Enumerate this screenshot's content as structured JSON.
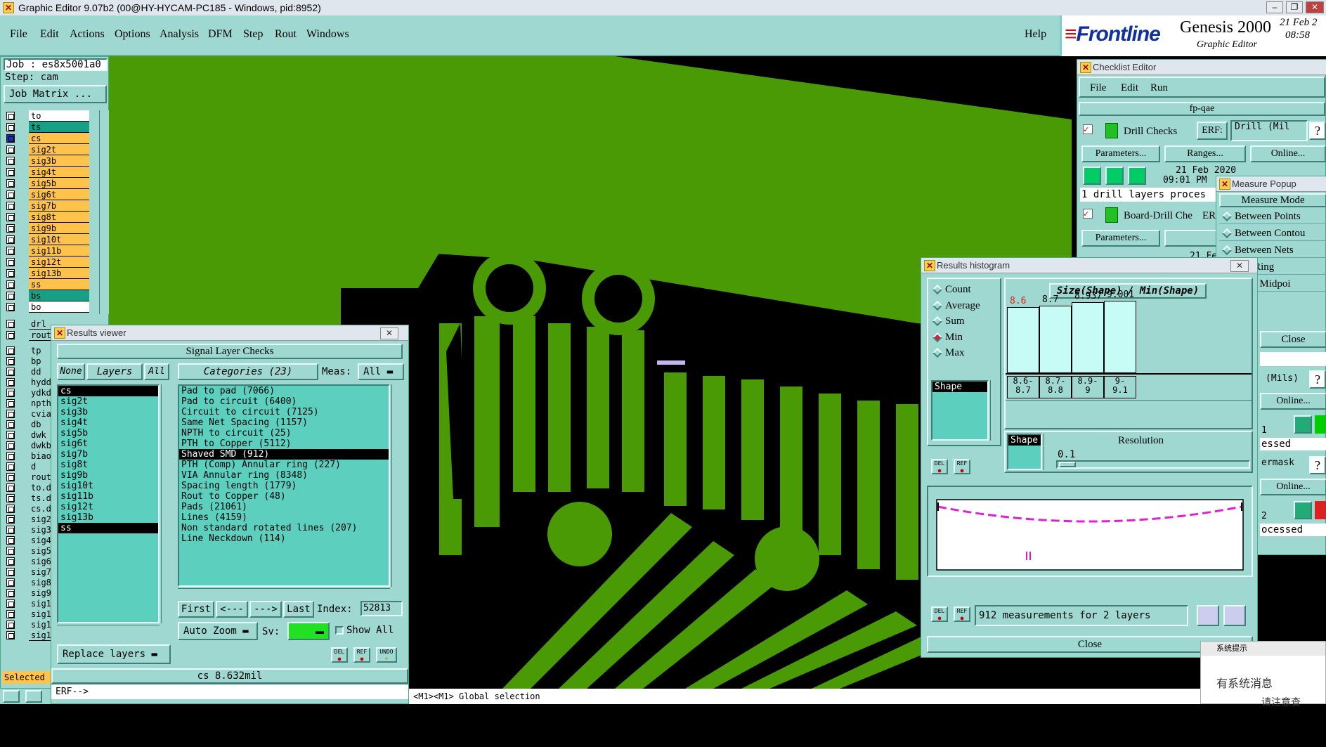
{
  "window": {
    "title": "Graphic Editor 9.07b2 (00@HY-HYCAM-PC185 - Windows, pid:8952)"
  },
  "menu": [
    "File",
    "Edit",
    "Actions",
    "Options",
    "Analysis",
    "DFM",
    "Step",
    "Rout",
    "Windows"
  ],
  "help": "Help",
  "brand": {
    "logo": "Frontline",
    "product": "Genesis 2000",
    "sub": "Graphic Editor",
    "date": "21 Feb 2",
    "time": "08:58 "
  },
  "job": {
    "job": "Job : es8x5001a0",
    "step": "Step: cam",
    "matrix": "Job Matrix ..."
  },
  "layers": [
    {
      "name": "to",
      "color": "#ffffff",
      "mark": "e"
    },
    {
      "name": "ts",
      "color": "#16a085"
    },
    {
      "name": "cs",
      "color": "#ffc24a",
      "mark": "▪",
      "active": true
    },
    {
      "name": "sig2t",
      "color": "#ffc24a"
    },
    {
      "name": "sig3b",
      "color": "#ffc24a"
    },
    {
      "name": "sig4t",
      "color": "#ffc24a"
    },
    {
      "name": "sig5b",
      "color": "#ffc24a"
    },
    {
      "name": "sig6t",
      "color": "#ffc24a"
    },
    {
      "name": "sig7b",
      "color": "#ffc24a"
    },
    {
      "name": "sig8t",
      "color": "#ffc24a"
    },
    {
      "name": "sig9b",
      "color": "#ffc24a"
    },
    {
      "name": "sig10t",
      "color": "#ffc24a"
    },
    {
      "name": "sig11b",
      "color": "#ffc24a"
    },
    {
      "name": "sig12t",
      "color": "#ffc24a"
    },
    {
      "name": "sig13b",
      "color": "#ffc24a"
    },
    {
      "name": "ss",
      "color": "#ffc24a"
    },
    {
      "name": "bs",
      "color": "#16a085"
    },
    {
      "name": "bo",
      "color": "#ffffff",
      "mark": "e"
    }
  ],
  "layers2": [
    "drl",
    "rout",
    "tp",
    "bp",
    "dd",
    "hydd",
    "ydkd",
    "npth",
    "cvia",
    "db",
    "dwk",
    "dwkb",
    "biao",
    "d",
    "rout",
    "to.d",
    "ts.d",
    "cs.d",
    "sig2",
    "sig3",
    "sig4",
    "sig5",
    "sig6",
    "sig7",
    "sig8",
    "sig9",
    "sig1",
    "sig1",
    "sig1",
    "sig1"
  ],
  "selected_label": "Selected",
  "results_viewer": {
    "title": "Results viewer",
    "header": "Signal Layer Checks",
    "none": "None",
    "layers_btn": "Layers",
    "all": "All",
    "categories": "Categories (23)",
    "meas_label": "Meas:",
    "meas_value": "All",
    "layer_list": [
      {
        "t": "cs",
        "sel": true
      },
      {
        "t": "sig2t"
      },
      {
        "t": "sig3b"
      },
      {
        "t": "sig4t"
      },
      {
        "t": "sig5b"
      },
      {
        "t": "sig6t"
      },
      {
        "t": "sig7b"
      },
      {
        "t": "sig8t"
      },
      {
        "t": "sig9b"
      },
      {
        "t": "sig10t"
      },
      {
        "t": "sig11b"
      },
      {
        "t": "sig12t"
      },
      {
        "t": "sig13b"
      },
      {
        "t": "ss",
        "sel": true
      }
    ],
    "cat_list": [
      {
        "t": "Pad to pad (7066)"
      },
      {
        "t": "Pad to circuit (6400)"
      },
      {
        "t": "Circuit to circuit (7125)"
      },
      {
        "t": "Same Net Spacing (1157)"
      },
      {
        "t": "NPTH to circuit (25)"
      },
      {
        "t": "PTH to Copper (5112)"
      },
      {
        "t": "Shaved SMD (912)",
        "sel": true
      },
      {
        "t": "PTH (Comp) Annular ring (227)"
      },
      {
        "t": "VIA Annular ring (8348)"
      },
      {
        "t": "Spacing length (1779)"
      },
      {
        "t": "Rout to Copper (48)"
      },
      {
        "t": "Pads (21061)"
      },
      {
        "t": "Lines (4159)"
      },
      {
        "t": "Non standard rotated lines (207)"
      },
      {
        "t": "Line Neckdown (114)"
      }
    ],
    "first": "First",
    "prev": "<---",
    "next": "--->",
    "last": "Last",
    "index_label": "Index:",
    "index_value": "52813",
    "auto_zoom": "Auto Zoom",
    "sv": "Sv:",
    "show_all": "Show All",
    "replace": "Replace layers",
    "del": "DEL",
    "ref": "REF",
    "undo": "UNDO",
    "status": "cs 8.632mil",
    "erf": "ERF-->"
  },
  "results_histogram": {
    "title": "Results histogram",
    "modes": [
      {
        "t": "Count"
      },
      {
        "t": "Average"
      },
      {
        "t": "Sum"
      },
      {
        "t": "Min",
        "on": true
      },
      {
        "t": "Max"
      }
    ],
    "shape": "Shape",
    "chart_title": "Size(Shape) / Min(Shape)",
    "bins": [
      {
        "value": "8.6",
        "range": "8.6-\n8.7",
        "h": 0.72,
        "red": true
      },
      {
        "value": "8.7",
        "range": "8.7-\n8.8",
        "h": 0.74
      },
      {
        "value": "8.937",
        "range": "8.9-\n9",
        "h": 0.78
      },
      {
        "value": "9.001",
        "range": "9-\n9.1",
        "h": 0.79
      }
    ],
    "shape2": "Shape",
    "resolution": "Resolution",
    "res_value": "0.1",
    "del": "DEL",
    "ref": "REF",
    "footer": "912 measurements for 2 layers",
    "close": "Close"
  },
  "checklist": {
    "title": "Checklist Editor",
    "menu": [
      "File",
      "Edit",
      "Run"
    ],
    "name": "fp-qae",
    "check1": "Drill Checks",
    "erf": "ERF:",
    "erf_value": "Drill (Mil",
    "parameters": "Parameters...",
    "ranges": "Ranges...",
    "online": "Online...",
    "date": "21 Feb 2020",
    "time": "09:01 PM",
    "status": "1 drill layers proces",
    "check2": "Board-Drill Che",
    "erf2": "ER",
    "ranges2": "Range",
    "date2": "21 Fe"
  },
  "measure_popup": {
    "title": "Measure Popup",
    "mode": "Measure Mode",
    "items": [
      "Between Points",
      "Between Contou",
      "Between Nets",
      "ular Ring",
      "ween Midpoi"
    ],
    "close": "Close",
    "mils": "(Mils)",
    "online": "Online...",
    "p1": "1",
    "processed": "essed",
    "mask": "ermask",
    "online2": "Online...",
    "p2": "2",
    "processed2": "ocessed"
  },
  "command": "<M1><M1> Global selection",
  "sys_notice": {
    "title": "系统提示",
    "line1": "有系统消息",
    "line2": "请注意查"
  }
}
